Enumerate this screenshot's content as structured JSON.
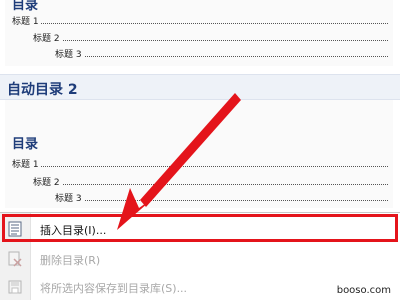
{
  "gallery_top": {
    "toc_heading": "目录",
    "entries": [
      "标题 1",
      "标题 2",
      "标题 3"
    ]
  },
  "gallery_section": {
    "title": "自动目录 2"
  },
  "gallery_preview": {
    "toc_heading": "目录",
    "entries": [
      "标题 1",
      "标题 2",
      "标题 3"
    ]
  },
  "menu": {
    "items": [
      {
        "label": "插入目录(I)...",
        "icon": "document-icon",
        "enabled": true
      },
      {
        "label": "删除目录(R)",
        "icon": "delete-toc-icon",
        "enabled": false
      },
      {
        "label": "将所选内容保存到目录库(S)...",
        "icon": "save-to-gallery-icon",
        "enabled": false
      }
    ]
  },
  "annotation": {
    "color": "#e4141b"
  },
  "watermark": "booso.com"
}
